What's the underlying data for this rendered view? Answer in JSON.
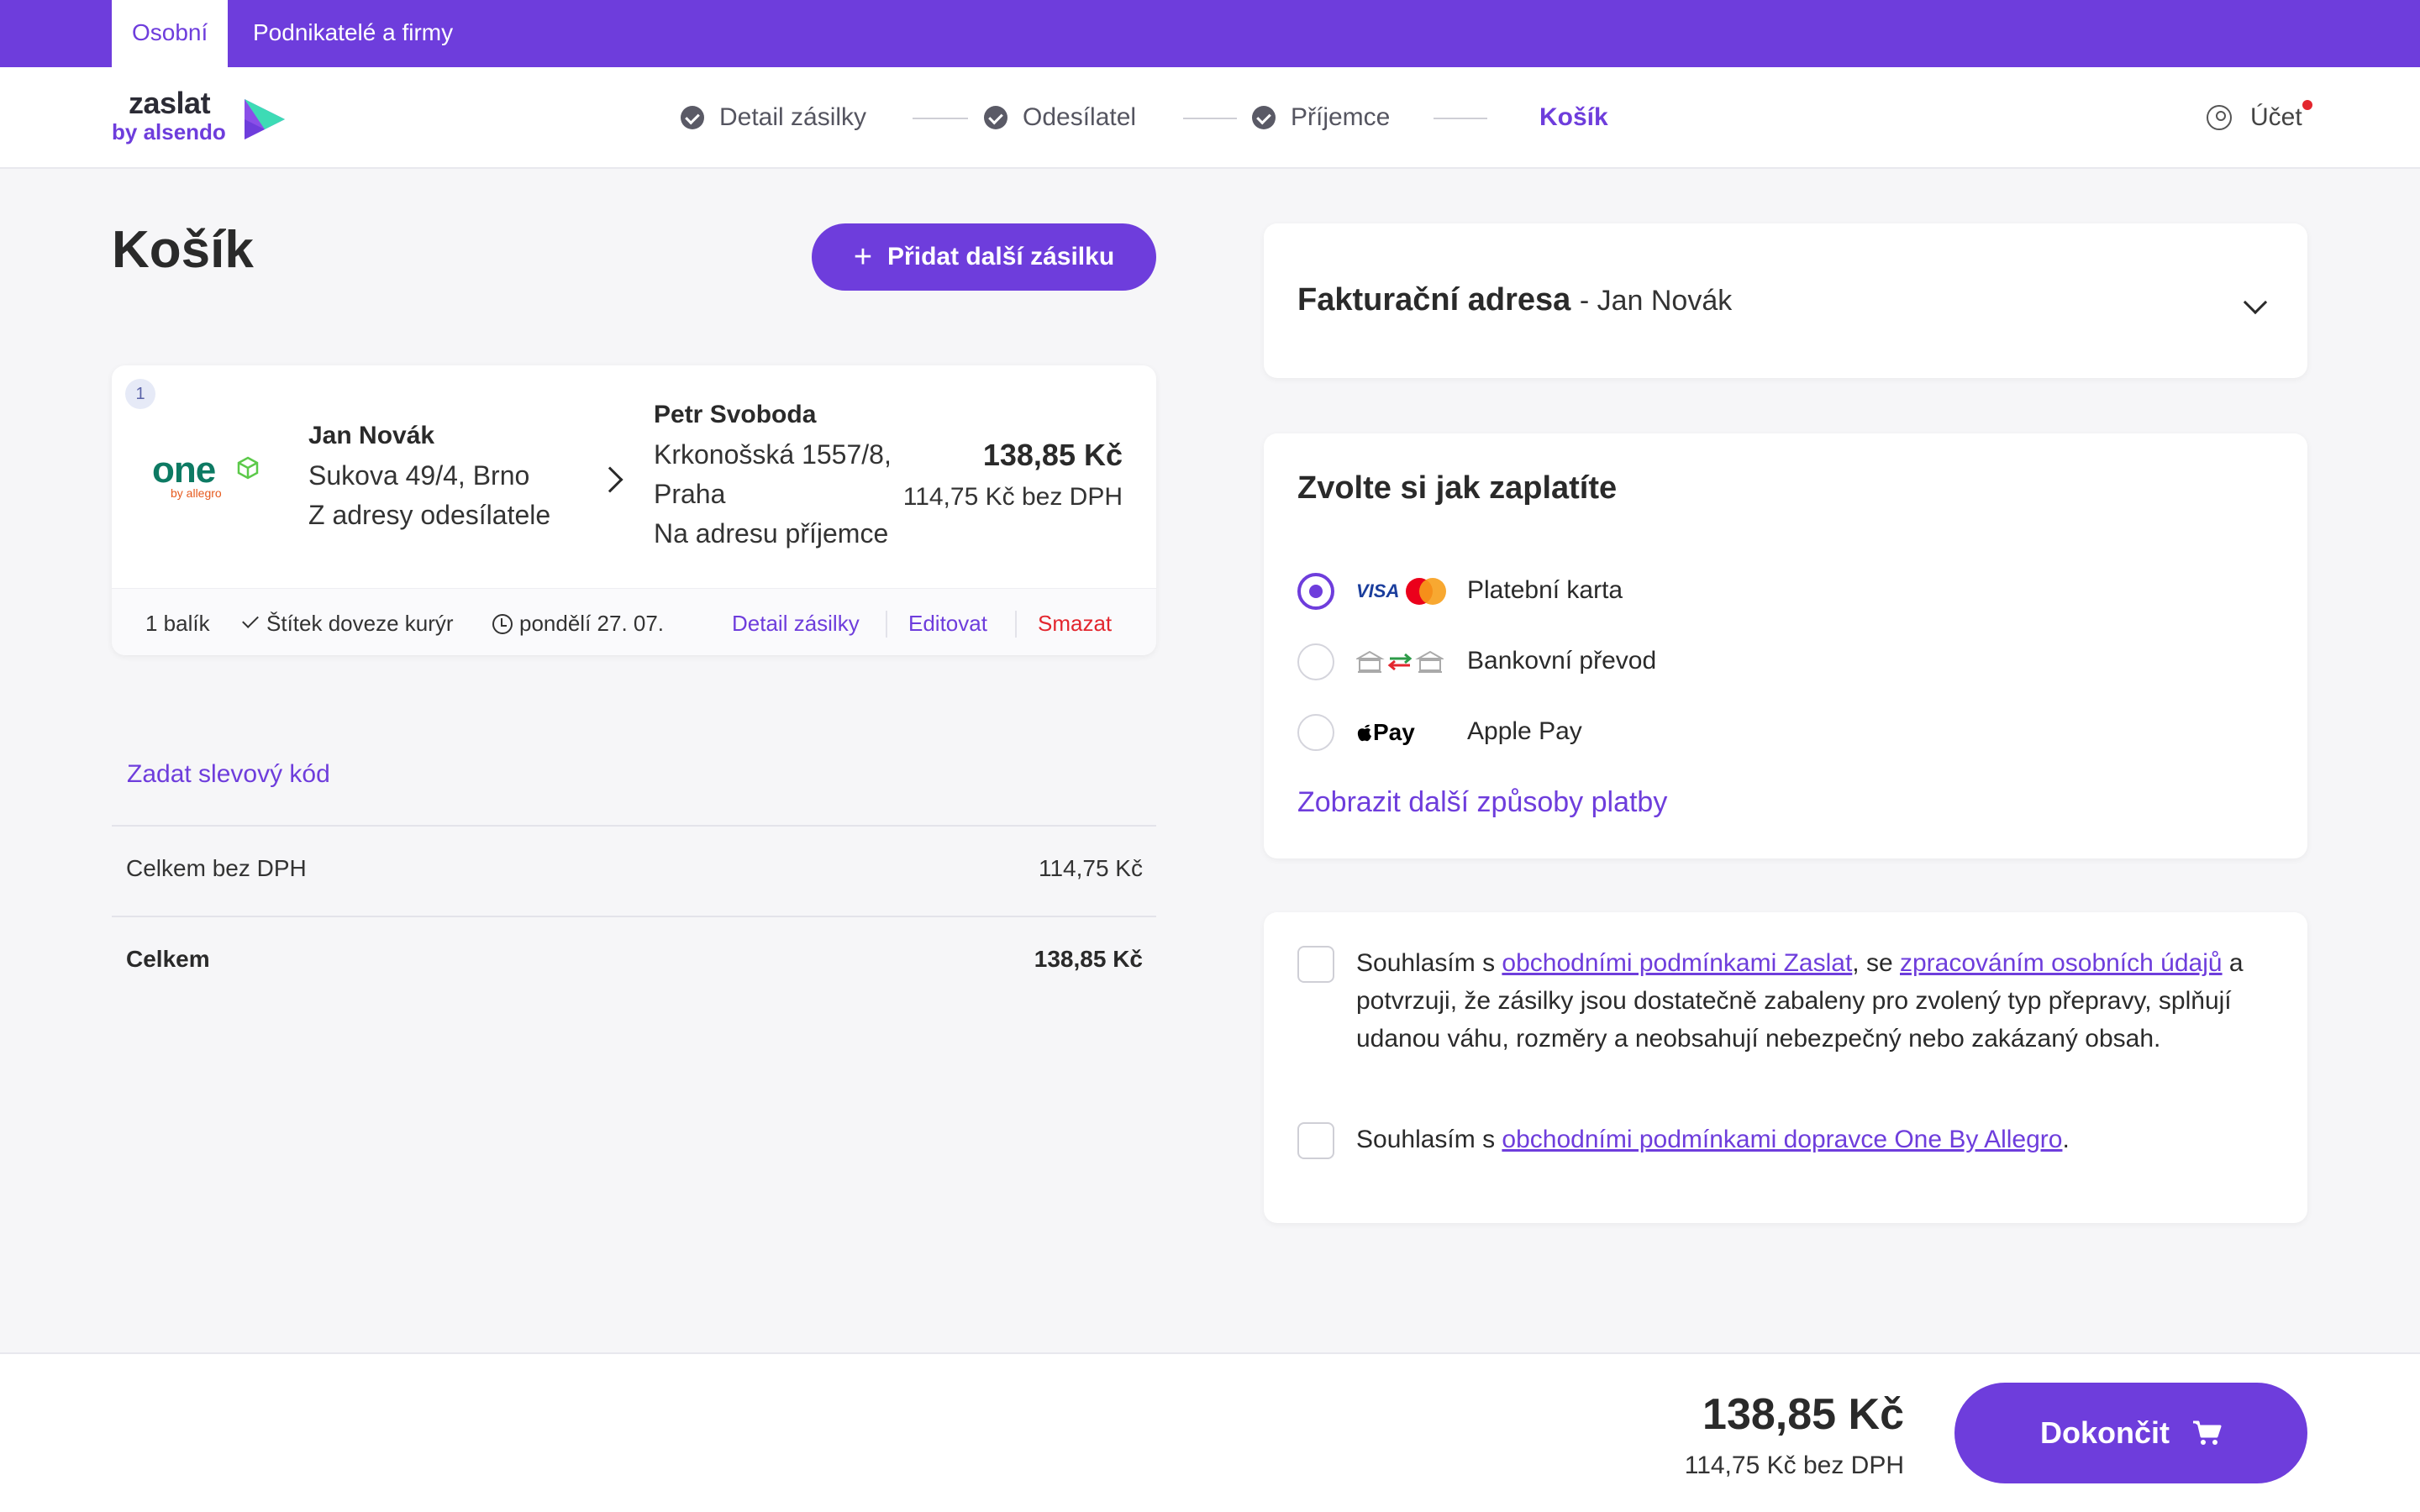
{
  "topbar": {
    "tabs": [
      {
        "label": "Osobní",
        "active": true
      },
      {
        "label": "Podnikatelé a firmy",
        "active": false
      }
    ]
  },
  "brand": {
    "name": "zaslat",
    "sub": "by alsendo"
  },
  "steps": [
    {
      "label": "Detail zásilky",
      "done": true
    },
    {
      "label": "Odesílatel",
      "done": true
    },
    {
      "label": "Příjemce",
      "done": true
    },
    {
      "label": "Košík",
      "current": true
    }
  ],
  "account": {
    "label": "Účet"
  },
  "cart": {
    "title": "Košík",
    "add_button": "Přidat další zásilku",
    "shipment": {
      "number": "1",
      "carrier": {
        "logo_text": "one",
        "logo_sub": "by allegro"
      },
      "sender": {
        "name": "Jan Novák",
        "address": "Sukova 49/4, Brno",
        "pickup": "Z adresy odesílatele"
      },
      "recipient": {
        "name": "Petr Svoboda",
        "address_line1": "Krkonošská 1557/8,",
        "address_line2": "Praha",
        "delivery": "Na adresu příjemce"
      },
      "price": "138,85 Kč",
      "price_ex_vat": "114,75 Kč bez DPH",
      "packages": "1 balík",
      "label_info": "Štítek doveze kurýr",
      "date": "pondělí 27. 07.",
      "actions": {
        "detail": "Detail zásilky",
        "edit": "Editovat",
        "delete": "Smazat"
      }
    },
    "discount_link": "Zadat slevový kód",
    "summary": [
      {
        "label": "Celkem bez DPH",
        "value": "114,75 Kč"
      },
      {
        "label": "Celkem",
        "value": "138,85 Kč"
      }
    ]
  },
  "billing": {
    "title": "Fakturační adresa",
    "name": "- Jan Novák"
  },
  "payment": {
    "title": "Zvolte si jak zaplatíte",
    "methods": [
      {
        "label": "Platební karta",
        "icon": "card-icons",
        "selected": true
      },
      {
        "label": "Bankovní převod",
        "icon": "bank-transfer-icon",
        "selected": false
      },
      {
        "label": "Apple Pay",
        "icon": "apple-pay-icon",
        "icon_text": "Pay",
        "selected": false
      }
    ],
    "more_link": "Zobrazit další způsoby platby"
  },
  "consents": {
    "first": {
      "prefix": "Souhlasím s ",
      "link1": "obchodními podmínkami Zaslat",
      "middle": ", se ",
      "link2": "zpracováním osobních údajů",
      "suffix": " a potvrzuji, že zásilky jsou dostatečně zabaleny pro zvolený typ přepravy, splňují udanou váhu, rozměry a neobsahují nebezpečný nebo zakázaný obsah."
    },
    "second": {
      "prefix": "Souhlasím s ",
      "link": "obchodními podmínkami dopravce One By Allegro",
      "suffix": "."
    }
  },
  "footer": {
    "total": "138,85 Kč",
    "total_ex_vat": "114,75 Kč bez DPH",
    "finish_button": "Dokončit"
  },
  "colors": {
    "accent": "#6e3ddc",
    "danger": "#e3262e",
    "carrier_green": "#0d7a63",
    "carrier_orange": "#e65a1e"
  }
}
